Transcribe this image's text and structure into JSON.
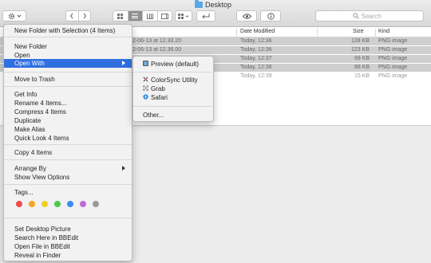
{
  "window": {
    "title": "Desktop"
  },
  "toolbar": {
    "search_placeholder": "Search"
  },
  "columns": {
    "date": "Date Modified",
    "size": "Size",
    "kind": "Kind"
  },
  "files": [
    {
      "name": "2-06-13 at 12.33.20",
      "date": "Today, 12:36",
      "size": "128 KB",
      "kind": "PNG image"
    },
    {
      "name": "2-06-13 at 12.36.00",
      "date": "Today, 12:36",
      "size": "123 KB",
      "kind": "PNG image"
    },
    {
      "name": "",
      "date": "Today, 12:37",
      "size": "68 KB",
      "kind": "PNG image"
    },
    {
      "name": "",
      "date": "Today, 12:36",
      "size": "68 KB",
      "kind": "PNG image"
    },
    {
      "name": "",
      "date": "Today, 12:39",
      "size": "15 KB",
      "kind": "PNG image"
    }
  ],
  "context_menu": {
    "new_folder_selection": "New Folder with Selection (4 Items)",
    "new_folder": "New Folder",
    "open": "Open",
    "open_with": "Open With",
    "move_to_trash": "Move to Trash",
    "get_info": "Get Info",
    "rename": "Rename 4 Items...",
    "compress": "Compress 4 Items",
    "duplicate": "Duplicate",
    "make_alias": "Make Alias",
    "quick_look": "Quick Look 4 Items",
    "copy": "Copy 4 Items",
    "arrange_by": "Arrange By",
    "show_view_options": "Show View Options",
    "tags": "Tags...",
    "tag_colors": [
      "#f04a4a",
      "#f5a623",
      "#f2d024",
      "#4cc84a",
      "#3c8ef0",
      "#c16ad8",
      "#9a9a9a"
    ],
    "set_desktop_picture": "Set Desktop Picture",
    "search_bbedit": "Search Here in BBEdit",
    "open_bbedit": "Open File in BBEdit",
    "reveal_finder": "Reveal in Finder"
  },
  "open_with_menu": {
    "preview": "Preview (default)",
    "colorsync": "ColorSync Utility",
    "grab": "Grab",
    "safari": "Safari",
    "other": "Other..."
  }
}
